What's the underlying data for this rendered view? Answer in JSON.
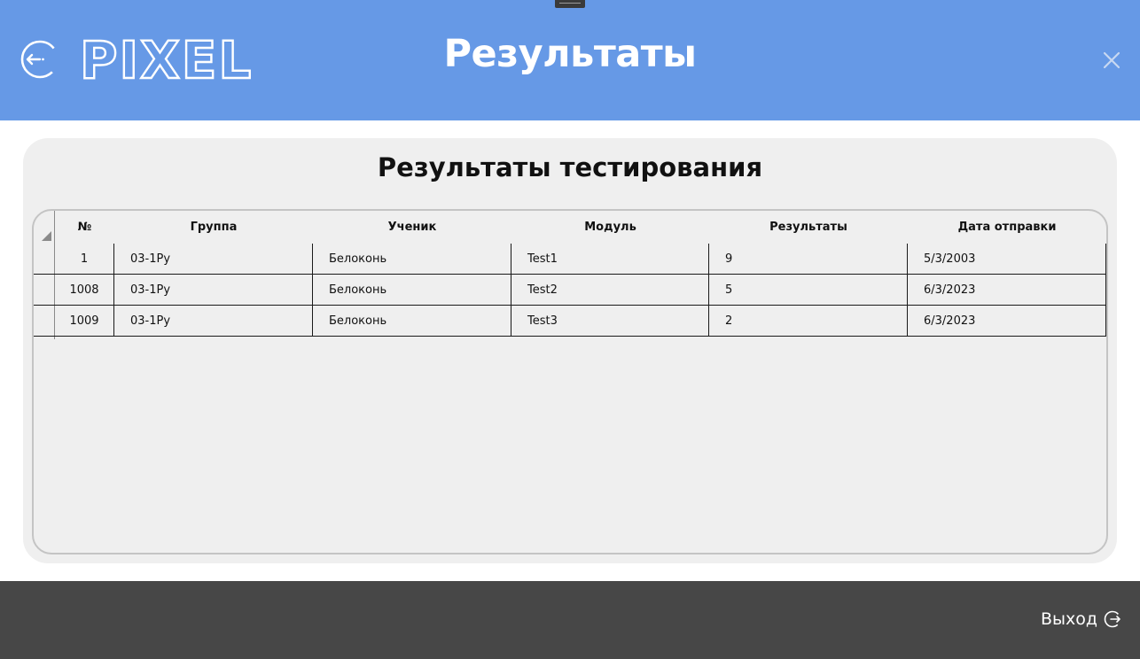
{
  "header": {
    "logo_text": "PIXEL",
    "title": "Результаты",
    "bg_color": "#6699e6"
  },
  "icons": {
    "back": "back-arrow-circle-icon",
    "close": "close-icon",
    "exit": "exit-icon",
    "grip": "window-grip-icon"
  },
  "panel": {
    "title": "Результаты тестирования"
  },
  "table": {
    "columns": [
      "№",
      "Группа",
      "Ученик",
      "Модуль",
      "Результаты",
      "Дата отправки"
    ],
    "rows": [
      [
        "1",
        "03-1Ру",
        "Белоконь",
        "Test1",
        "9",
        "5/3/2003"
      ],
      [
        "1008",
        "03-1Ру",
        "Белоконь",
        "Test2",
        "5",
        "6/3/2023"
      ],
      [
        "1009",
        "03-1Ру",
        "Белоконь",
        "Test3",
        "2",
        "6/3/2023"
      ]
    ]
  },
  "footer": {
    "exit_label": "Выход",
    "bg_color": "#474747"
  }
}
